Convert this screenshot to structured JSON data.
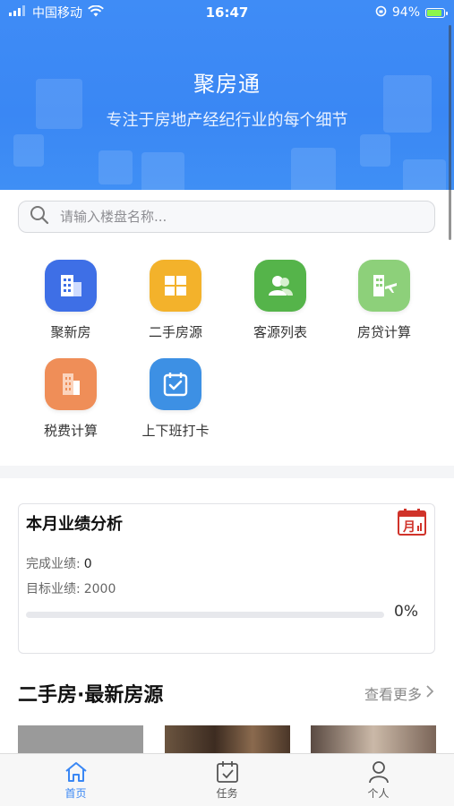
{
  "status_bar": {
    "carrier": "中国移动",
    "time": "16:47",
    "battery": "94%"
  },
  "banner": {
    "title": "聚房通",
    "subtitle": "专注于房地产经纪行业的每个细节"
  },
  "search": {
    "placeholder": "请输入楼盘名称..."
  },
  "grid": {
    "items": [
      {
        "label": "聚新房",
        "icon": "building-icon",
        "color": "#3e6fe6"
      },
      {
        "label": "二手房源",
        "icon": "windows-icon",
        "color": "#f3b22b"
      },
      {
        "label": "客源列表",
        "icon": "users-icon",
        "color": "#55b44a"
      },
      {
        "label": "房贷计算",
        "icon": "building-plane-icon",
        "color": "#8dd07a"
      },
      {
        "label": "税费计算",
        "icon": "office-building-icon",
        "color": "#ef8e58"
      },
      {
        "label": "上下班打卡",
        "icon": "calendar-check-icon",
        "color": "#3d90e4"
      }
    ]
  },
  "performance": {
    "title": "本月业绩分析",
    "completed_label": "完成业绩:",
    "completed_value": "0",
    "target_label": "目标业绩:",
    "target_value": "2000",
    "progress_percent": "0%",
    "progress_fraction": 0,
    "icon": "calendar-chart-icon",
    "icon_char": "月"
  },
  "listings": {
    "title": "二手房·最新房源",
    "more_label": "查看更多"
  },
  "tabbar": {
    "items": [
      {
        "label": "首页",
        "icon": "home-icon",
        "active": true
      },
      {
        "label": "任务",
        "icon": "task-calendar-icon",
        "active": false
      },
      {
        "label": "个人",
        "icon": "person-icon",
        "active": false
      }
    ]
  }
}
